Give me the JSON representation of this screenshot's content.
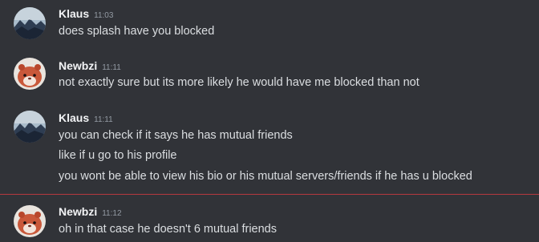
{
  "messages": [
    {
      "username": "Klaus",
      "time": "11:03",
      "avatar_icon": "mountain-landscape-avatar-icon",
      "lines": [
        "does splash have you blocked"
      ]
    },
    {
      "username": "Newbzi",
      "time": "11:11",
      "avatar_icon": "hamster-avatar-icon",
      "lines": [
        "not exactly sure but its more likely he would have me blocked than not"
      ]
    },
    {
      "username": "Klaus",
      "time": "11:11",
      "avatar_icon": "mountain-landscape-avatar-icon",
      "lines": [
        "you can check if it says he has mutual friends",
        "like if u go to his profile",
        "you wont be able to view his bio or his mutual servers/friends if he has u blocked"
      ]
    },
    {
      "username": "Newbzi",
      "time": "11:12",
      "avatar_icon": "hamster-avatar-icon",
      "lines": [
        "oh in that case he doesn't 6 mutual friends"
      ]
    }
  ],
  "colors": {
    "background": "#313338",
    "username": "#f2f3f5",
    "timestamp": "#949ba4",
    "message_text": "#dbdee1",
    "new_messages_divider": "#b5383f"
  }
}
